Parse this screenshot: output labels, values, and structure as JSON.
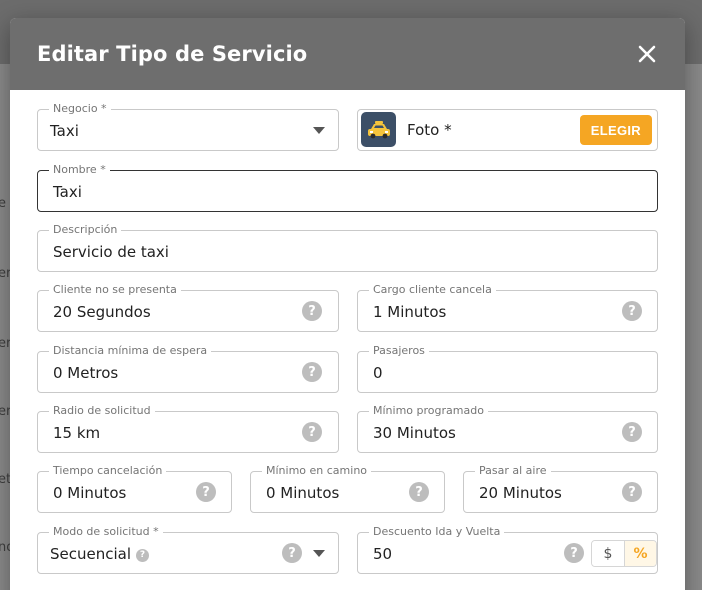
{
  "dialog": {
    "title": "Editar Tipo de Servicio"
  },
  "colors": {
    "accent": "#f5a623",
    "header": "#6e6e6e",
    "help_icon": "#bdbdbd"
  },
  "fields": {
    "negocio": {
      "label": "Negocio *",
      "value": "Taxi"
    },
    "foto": {
      "label": "Foto *",
      "button": "ELEGIR",
      "icon": "taxi-icon"
    },
    "nombre": {
      "label": "Nombre *",
      "value": "Taxi"
    },
    "descripcion": {
      "label": "Descripción",
      "value": "Servicio de taxi"
    },
    "cliente_no_presenta": {
      "label": "Cliente no se presenta",
      "value": "20 Segundos"
    },
    "cargo_cliente_cancela": {
      "label": "Cargo cliente cancela",
      "value": "1 Minutos"
    },
    "distancia_minima": {
      "label": "Distancia mínima de espera",
      "value": "0 Metros"
    },
    "pasajeros": {
      "label": "Pasajeros",
      "value": "0"
    },
    "radio_solicitud": {
      "label": "Radio de solicitud",
      "value": "15 km"
    },
    "minimo_programado": {
      "label": "Mínimo programado",
      "value": "30 Minutos"
    },
    "tiempo_cancelacion": {
      "label": "Tiempo cancelación",
      "value": "0 Minutos"
    },
    "minimo_en_camino": {
      "label": "Mínimo en camino",
      "value": "0 Minutos"
    },
    "pasar_al_aire": {
      "label": "Pasar al aire",
      "value": "20 Minutos"
    },
    "modo_solicitud": {
      "label": "Modo de solicitud *",
      "value": "Secuencial"
    },
    "descuento": {
      "label": "Descuento Ida y Vuelta",
      "value": "50",
      "options": [
        "$",
        "%"
      ],
      "selected": "%"
    }
  }
}
